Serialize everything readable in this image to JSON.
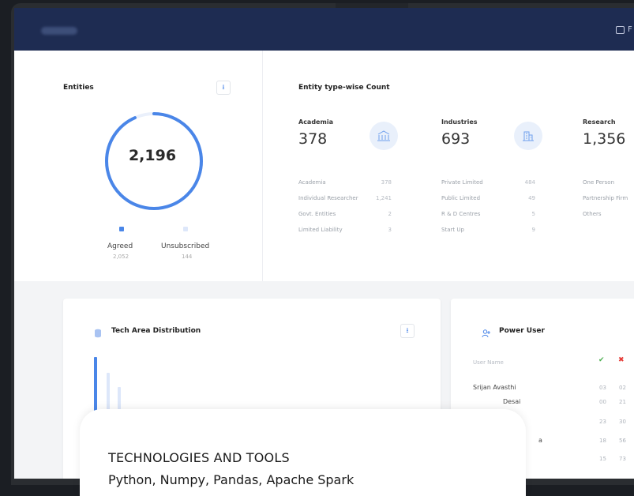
{
  "header": {
    "action_label": "F"
  },
  "entities_card": {
    "title": "Entities",
    "download_icon": "download-icon",
    "total": "2,196",
    "legend": [
      {
        "label": "Agreed",
        "value": "2,052",
        "color": "#4a86e8"
      },
      {
        "label": "Unsubscribed",
        "value": "144",
        "color": "#dde7fa"
      }
    ],
    "agreed_fraction": 0.934
  },
  "entity_types": {
    "title": "Entity type-wise Count",
    "categories": [
      {
        "name": "Academia",
        "count": "378",
        "icon": "university-icon",
        "rows": [
          {
            "label": "Academia",
            "value": "378"
          },
          {
            "label": "Individual Researcher",
            "value": "1,241"
          },
          {
            "label": "Govt. Entities",
            "value": "2"
          },
          {
            "label": "Limited Liability",
            "value": "3"
          }
        ]
      },
      {
        "name": "Industries",
        "count": "693",
        "icon": "building-icon",
        "rows": [
          {
            "label": "Private Limited",
            "value": "484"
          },
          {
            "label": "Public Limited",
            "value": "49"
          },
          {
            "label": "R & D Centres",
            "value": "5"
          },
          {
            "label": "Start Up",
            "value": "9"
          }
        ]
      },
      {
        "name": "Research",
        "count": "1,356",
        "icon": "research-icon",
        "rows": [
          {
            "label": "One Person",
            "value": ""
          },
          {
            "label": "Partnership Firm",
            "value": ""
          },
          {
            "label": "Others",
            "value": ""
          }
        ]
      }
    ]
  },
  "tech_area": {
    "title": "Tech Area Distribution",
    "icon": "database-icon"
  },
  "power_user": {
    "title": "Power User",
    "icon": "users-icon",
    "column_header": "User Name",
    "check_icon": "check-icon",
    "cross_icon": "cross-icon",
    "check_color": "#4caf50",
    "cross_color": "#e53935",
    "rows": [
      {
        "name": "Srijan Avasthi",
        "a": "03",
        "b": "02"
      },
      {
        "name": "Desai",
        "a": "00",
        "b": "21"
      },
      {
        "name": "",
        "a": "23",
        "b": "30"
      },
      {
        "name": "a",
        "a": "18",
        "b": "56"
      },
      {
        "name": "",
        "a": "15",
        "b": "73"
      }
    ]
  },
  "overlay": {
    "title": "TECHNOLOGIES AND TOOLS",
    "text": "Python, Numpy, Pandas, Apache Spark"
  }
}
